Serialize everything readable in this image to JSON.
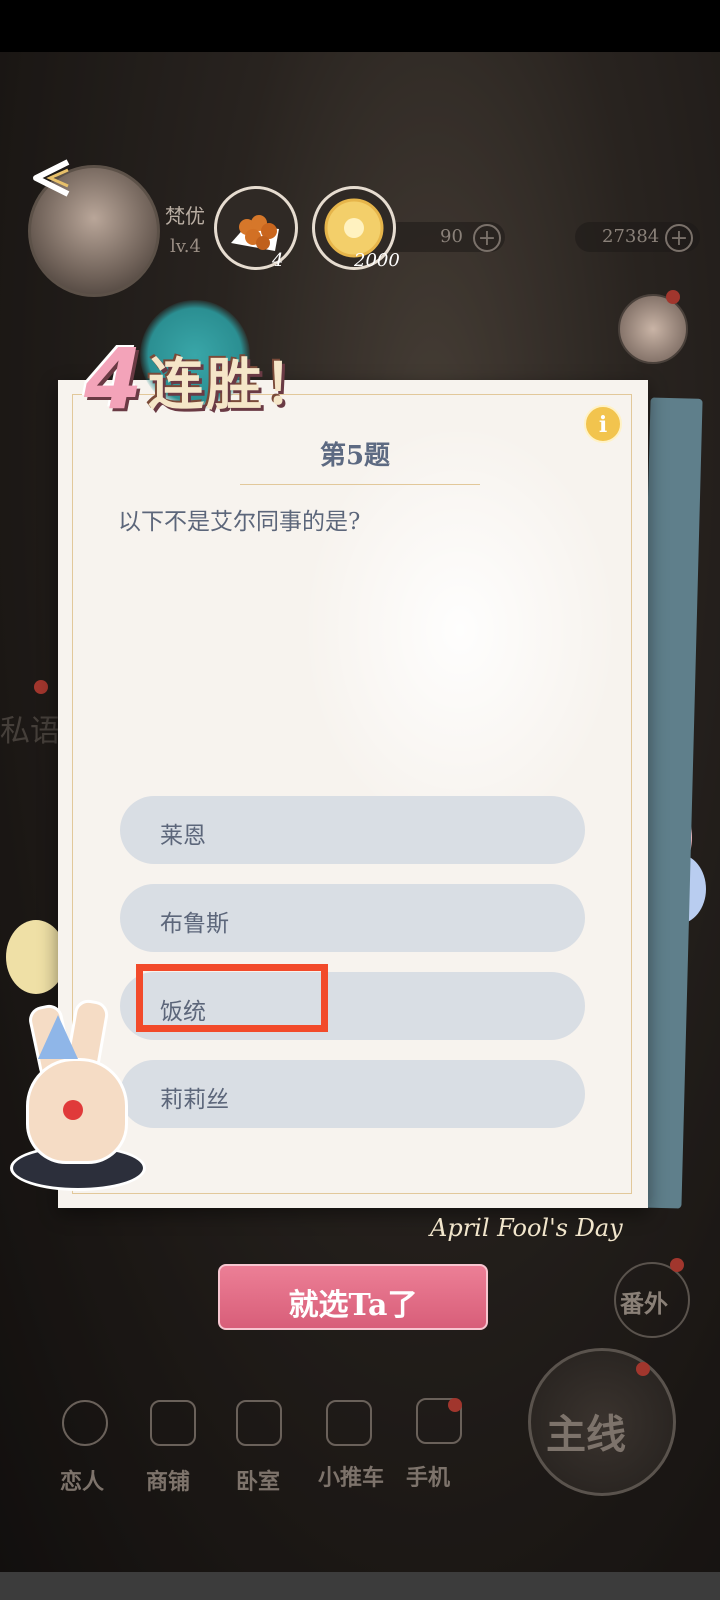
{
  "hud": {
    "player_name": "梵优",
    "player_level": "lv.4",
    "resource_1_value": "90",
    "resource_2_value": "27384",
    "reward_waffle_count": "4",
    "reward_coin_count": "2000"
  },
  "streak": {
    "count": "4",
    "label": "连胜！"
  },
  "quiz": {
    "question_number": "第5题",
    "question": "以下不是艾尔同事的是?",
    "info_icon": "i",
    "options": [
      {
        "label": "莱恩"
      },
      {
        "label": "布鲁斯"
      },
      {
        "label": "饭统"
      },
      {
        "label": "莉莉丝"
      }
    ],
    "highlighted_option_index": 2,
    "footer_script": "April Fool's Day"
  },
  "confirm_button": {
    "label": "就选Ta了"
  },
  "side": {
    "left_label": "私语"
  },
  "nav": {
    "items": [
      {
        "label": "恋人",
        "icon": "lover-icon"
      },
      {
        "label": "商铺",
        "icon": "shop-bag-icon"
      },
      {
        "label": "卧室",
        "icon": "bedroom-icon"
      },
      {
        "label": "小推车",
        "icon": "cart-icon"
      },
      {
        "label": "手机",
        "icon": "phone-icon"
      }
    ],
    "extra_label": "番外",
    "main_label": "主线"
  },
  "colors": {
    "highlight": "#f24a2a",
    "confirm": "#e0718a",
    "option_bg": "#d9dee4",
    "text": "#5c667a"
  }
}
